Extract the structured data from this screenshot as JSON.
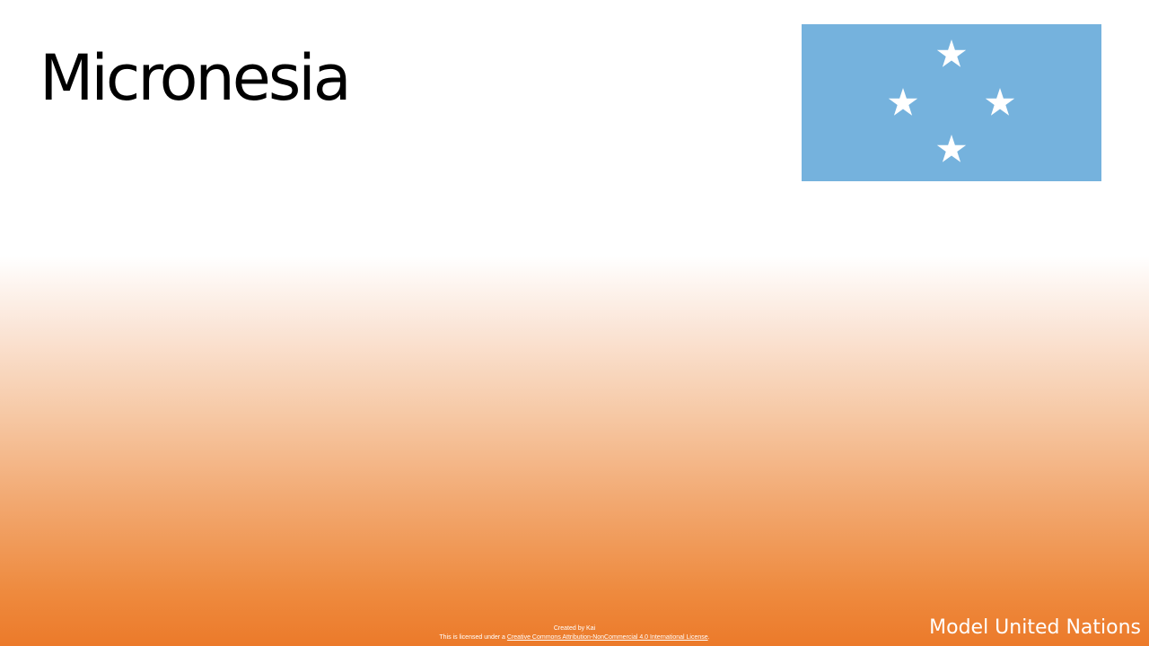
{
  "slide": {
    "title": "Micronesia",
    "flag": {
      "country": "Micronesia",
      "background_color": "#75b2dd",
      "star_color": "#ffffff",
      "star_count": 4,
      "icon": "flag-of-micronesia-icon"
    }
  },
  "footer": {
    "created_by": "Created by Kai",
    "license_prefix": "This is licensed under a",
    "license_link": "Creative Commons Attribution-NonCommercial 4.0 International License",
    "license_suffix": ".",
    "brand": "Model United Nations"
  },
  "colors": {
    "gradient_top": "#ffffff",
    "gradient_bottom": "#ec7a2a",
    "text_primary": "#000000",
    "text_footer": "#ffffff"
  }
}
